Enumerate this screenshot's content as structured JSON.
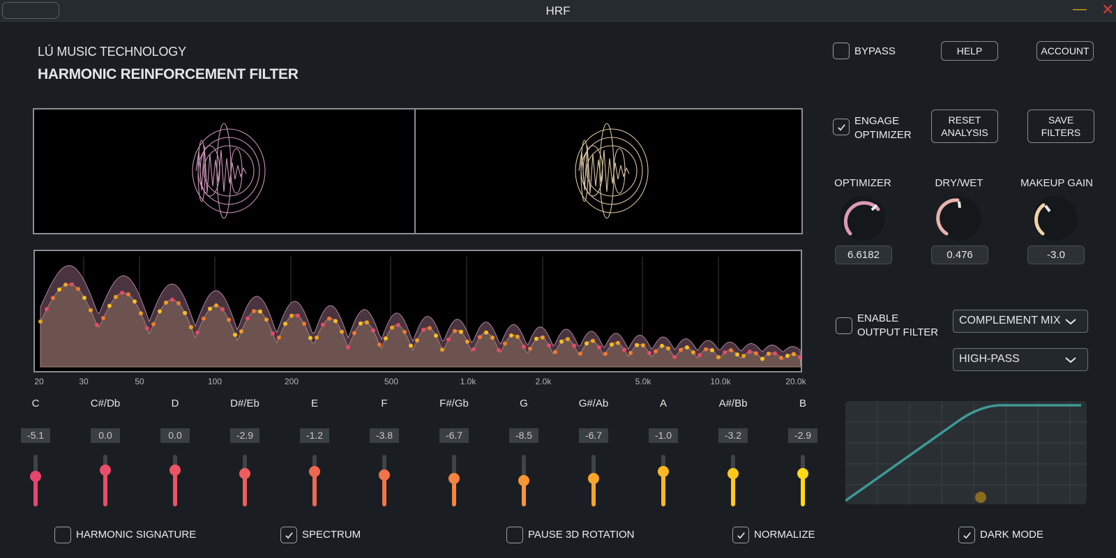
{
  "window": {
    "title": "HRF"
  },
  "header": {
    "brand": "LÚ MUSIC TECHNOLOGY",
    "product": "HARMONIC REINFORCEMENT FILTER"
  },
  "top_controls": {
    "bypass": {
      "label": "BYPASS",
      "checked": false
    },
    "help_label": "HELP",
    "account_label": "ACCOUNT",
    "engage_optimizer": {
      "label_line1": "ENGAGE",
      "label_line2": "OPTIMIZER",
      "checked": true
    },
    "reset_line1": "RESET",
    "reset_line2": "ANALYSIS",
    "save_label": "SAVE FILTERS"
  },
  "knobs": [
    {
      "label": "OPTIMIZER",
      "value": "6.6182",
      "color": "#d99ab8"
    },
    {
      "label": "DRY/WET",
      "value": "0.476",
      "color": "#e8b2b0"
    },
    {
      "label": "MAKEUP GAIN",
      "value": "-3.0",
      "color": "#f1d2a8"
    }
  ],
  "output_filter": {
    "label_line1": "ENABLE",
    "label_line2": "OUTPUT FILTER",
    "checked": false,
    "mix_mode": "COMPLEMENT MIX",
    "filter_type": "HIGH-PASS",
    "curve_color": "#3e9a95"
  },
  "spectrum": {
    "freq_labels": [
      "20",
      "30",
      "50",
      "100",
      "200",
      "500",
      "1.0k",
      "2.0k",
      "5.0k",
      "10.0k",
      "20.0k"
    ]
  },
  "notes": [
    {
      "name": "C",
      "value": "-5.1",
      "level": 0.58,
      "color": "#e8456e"
    },
    {
      "name": "C#/Db",
      "value": "0.0",
      "level": 0.7,
      "color": "#ea4d69"
    },
    {
      "name": "D",
      "value": "0.0",
      "level": 0.7,
      "color": "#ec5464"
    },
    {
      "name": "D#/Eb",
      "value": "-2.9",
      "level": 0.64,
      "color": "#ee5e5c"
    },
    {
      "name": "E",
      "value": "-1.2",
      "level": 0.67,
      "color": "#f06853"
    },
    {
      "name": "F",
      "value": "-3.8",
      "level": 0.61,
      "color": "#f3744a"
    },
    {
      "name": "F#/Gb",
      "value": "-6.7",
      "level": 0.54,
      "color": "#f6833f"
    },
    {
      "name": "G",
      "value": "-8.5",
      "level": 0.5,
      "color": "#f89534"
    },
    {
      "name": "G#/Ab",
      "value": "-6.7",
      "level": 0.54,
      "color": "#faa52a"
    },
    {
      "name": "A",
      "value": "-1.0",
      "level": 0.67,
      "color": "#fcb822"
    },
    {
      "name": "A#/Bb",
      "value": "-3.2",
      "level": 0.63,
      "color": "#fdc91b"
    },
    {
      "name": "B",
      "value": "-2.9",
      "level": 0.64,
      "color": "#fed916"
    }
  ],
  "bottom_toggles": [
    {
      "label": "HARMONIC SIGNATURE",
      "checked": false
    },
    {
      "label": "SPECTRUM",
      "checked": true
    },
    {
      "label": "PAUSE 3D ROTATION",
      "checked": false
    },
    {
      "label": "NORMALIZE",
      "checked": true
    },
    {
      "label": "DARK MODE",
      "checked": true
    }
  ],
  "colors": {
    "accent_scope_left": "#e4a6cf",
    "accent_scope_right": "#f5ddb4",
    "spectrum_fill": "#6e5550"
  }
}
